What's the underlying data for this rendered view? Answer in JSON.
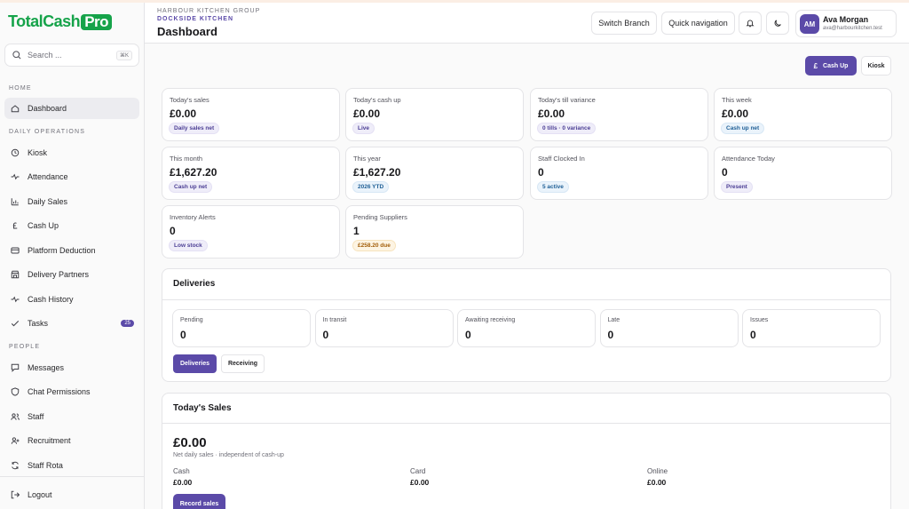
{
  "brand": {
    "name": "TotalCash",
    "badge": "Pro",
    "color": "#16a34a"
  },
  "accent": "#5b4aa8",
  "search": {
    "placeholder": "Search ...",
    "shortcut": "⌘K"
  },
  "sidebar": {
    "sections": [
      {
        "title": "HOME",
        "items": [
          {
            "label": "Dashboard",
            "icon": "home-icon",
            "active": true
          }
        ]
      },
      {
        "title": "DAILY OPERATIONS",
        "items": [
          {
            "label": "Kiosk",
            "icon": "clock-icon"
          },
          {
            "label": "Attendance",
            "icon": "activity-icon"
          },
          {
            "label": "Daily Sales",
            "icon": "bar-chart-icon"
          },
          {
            "label": "Cash Up",
            "icon": "currency-icon"
          },
          {
            "label": "Platform Deduction",
            "icon": "card-icon"
          },
          {
            "label": "Delivery Partners",
            "icon": "store-icon"
          },
          {
            "label": "Cash History",
            "icon": "activity-icon"
          },
          {
            "label": "Tasks",
            "icon": "check-icon",
            "badge": "25"
          }
        ]
      },
      {
        "title": "PEOPLE",
        "items": [
          {
            "label": "Messages",
            "icon": "message-icon"
          },
          {
            "label": "Chat Permissions",
            "icon": "shield-icon"
          },
          {
            "label": "Staff",
            "icon": "users-icon"
          },
          {
            "label": "Recruitment",
            "icon": "user-plus-icon"
          },
          {
            "label": "Staff Rota",
            "icon": "refresh-icon"
          }
        ]
      }
    ],
    "logout": "Logout"
  },
  "header": {
    "group": "HARBOUR KITCHEN GROUP",
    "kitchen": "DOCKSIDE KITCHEN",
    "title": "Dashboard",
    "switch_branch": "Switch Branch",
    "quick_nav": "Quick navigation",
    "user": {
      "initials": "AM",
      "name": "Ava Morgan",
      "email": "ava@harbourkitchen.test"
    }
  },
  "actions": {
    "cash_up": "Cash Up",
    "kiosk": "Kiosk"
  },
  "stats": [
    {
      "label": "Today's sales",
      "value": "£0.00",
      "chip": "Daily sales net",
      "chip_style": "purple"
    },
    {
      "label": "Today's cash up",
      "value": "£0.00",
      "chip": "Live",
      "chip_style": "purple"
    },
    {
      "label": "Today's till variance",
      "value": "£0.00",
      "chip": "0 tills · 0 variance",
      "chip_style": "purple"
    },
    {
      "label": "This week",
      "value": "£0.00",
      "chip": "Cash up net",
      "chip_style": "blue"
    },
    {
      "label": "This month",
      "value": "£1,627.20",
      "chip": "Cash up net",
      "chip_style": "purple"
    },
    {
      "label": "This year",
      "value": "£1,627.20",
      "chip": "2026 YTD",
      "chip_style": "blue"
    },
    {
      "label": "Staff Clocked In",
      "value": "0",
      "chip": "5 active",
      "chip_style": "blue"
    },
    {
      "label": "Attendance Today",
      "value": "0",
      "chip": "Present",
      "chip_style": "purple"
    },
    {
      "label": "Inventory Alerts",
      "value": "0",
      "chip": "Low stock",
      "chip_style": "purple"
    },
    {
      "label": "Pending Suppliers",
      "value": "1",
      "chip": "£258.20 due",
      "chip_style": "amber"
    }
  ],
  "deliveries": {
    "title": "Deliveries",
    "cells": [
      {
        "label": "Pending",
        "value": "0"
      },
      {
        "label": "In transit",
        "value": "0"
      },
      {
        "label": "Awaiting receiving",
        "value": "0"
      },
      {
        "label": "Late",
        "value": "0"
      },
      {
        "label": "Issues",
        "value": "0"
      }
    ],
    "tabs": [
      {
        "label": "Deliveries",
        "active": true
      },
      {
        "label": "Receiving",
        "active": false
      }
    ]
  },
  "todays_sales": {
    "title": "Today's Sales",
    "total": "£0.00",
    "subtitle": "Net daily sales · independent of cash-up",
    "breakdown": [
      {
        "label": "Cash",
        "value": "£0.00"
      },
      {
        "label": "Card",
        "value": "£0.00"
      },
      {
        "label": "Online",
        "value": "£0.00"
      }
    ],
    "record_button": "Record sales"
  }
}
